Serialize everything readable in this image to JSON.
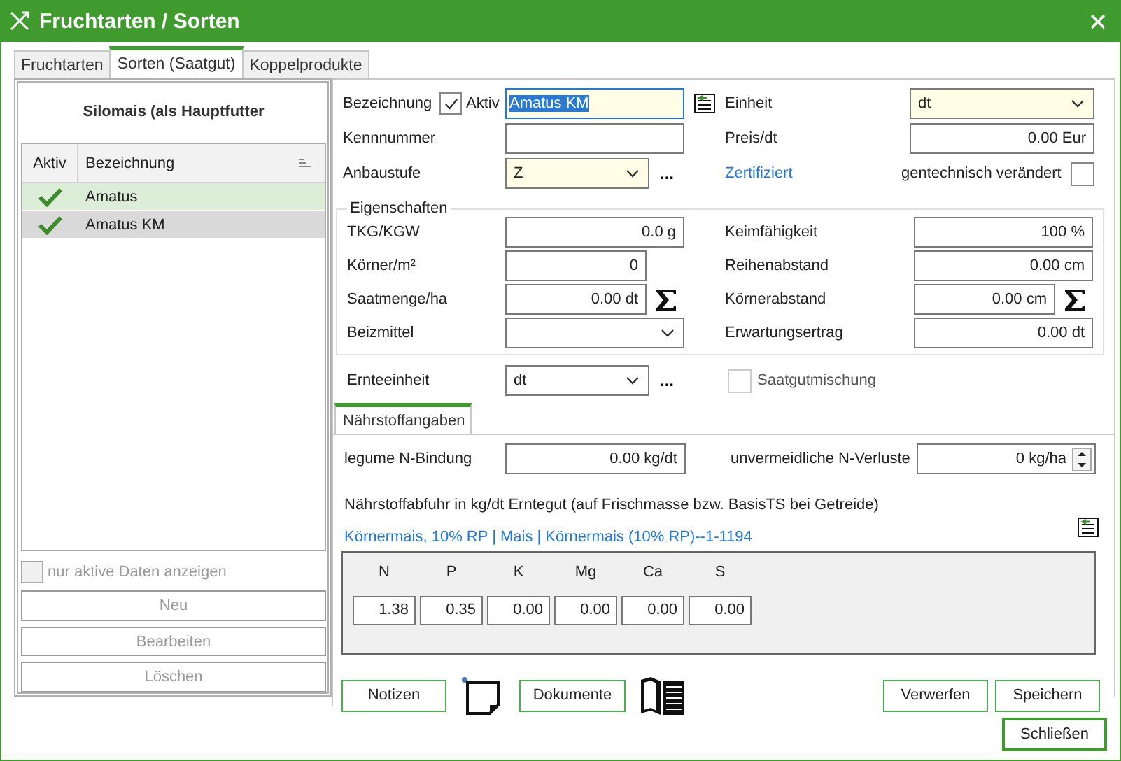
{
  "window": {
    "title": "Fruchtarten / Sorten"
  },
  "tabs": [
    {
      "label": "Fruchtarten",
      "selected": false
    },
    {
      "label": "Sorten (Saatgut)",
      "selected": true
    },
    {
      "label": "Koppelprodukte",
      "selected": false
    }
  ],
  "sidebar": {
    "heading": "Silomais (als Hauptfutter",
    "columns": [
      "Aktiv",
      "Bezeichnung"
    ],
    "rows": [
      {
        "active": true,
        "name": "Amatus",
        "selected": false,
        "hovered": true
      },
      {
        "active": true,
        "name": "Amatus KM",
        "selected": true,
        "hovered": false
      }
    ],
    "only_active": {
      "label": "nur aktive Daten anzeigen",
      "checked": false,
      "disabled": true
    },
    "buttons": [
      {
        "label": "Neu",
        "disabled": true
      },
      {
        "label": "Bearbeiten",
        "disabled": true
      },
      {
        "label": "Löschen",
        "disabled": true
      }
    ]
  },
  "form": {
    "name": {
      "label": "Bezeichnung",
      "active_label": "Aktiv",
      "active": true,
      "value": "Amatus KM",
      "required": true
    },
    "number": {
      "label": "Kennnummer"
    },
    "stage": {
      "label": "Anbaustufe",
      "value": "Z",
      "required": true,
      "more": "..."
    },
    "unit": {
      "label": "Einheit",
      "value": "dt",
      "required": true
    },
    "price": {
      "label": "Preis/dt",
      "value": "0.00 Eur"
    },
    "certified": {
      "label": "Zertifiziert"
    },
    "gmo": {
      "label": "gentechnisch verändert",
      "checked": false
    },
    "properties": {
      "title": "Eigenschaften",
      "left": [
        {
          "kind": "text",
          "label": "TKG/KGW",
          "value": "0.0 g"
        },
        {
          "kind": "text",
          "label": "Körner/m²",
          "value": "0"
        },
        {
          "kind": "sum",
          "label": "Saatmenge/ha",
          "value": "0.00 dt"
        },
        {
          "kind": "combo",
          "label": "Beizmittel"
        }
      ],
      "right": [
        {
          "kind": "text",
          "label": "Keimfähigkeit",
          "value": "100 %"
        },
        {
          "kind": "text",
          "label": "Reihenabstand",
          "value": "0.00 cm"
        },
        {
          "kind": "sum",
          "label": "Körnerabstand",
          "value": "0.00 cm"
        },
        {
          "kind": "text",
          "label": "Erwartungsertrag",
          "value": "0.00 dt"
        }
      ]
    },
    "harvest_unit": {
      "label": "Ernteeinheit",
      "value": "dt",
      "more": "..."
    },
    "seed_mix": {
      "label": "Saatgutmischung",
      "checked": false,
      "disabled": true
    }
  },
  "nutrients": {
    "tab": "Nährstoffangaben",
    "legume": {
      "label": "legume N-Bindung",
      "value": "0.00 kg/dt"
    },
    "losses": {
      "label": "unvermeidliche N-Verluste",
      "value": "0 kg/ha"
    },
    "note": "Nährstoffabfuhr in kg/dt Erntegut (auf Frischmasse bzw. BasisTS bei Getreide)",
    "source": "Körnermais, 10% RP | Mais | Körnermais (10% RP)--1-1194",
    "table": {
      "columns": [
        "N",
        "P",
        "K",
        "Mg",
        "Ca",
        "S"
      ],
      "values": [
        "1.38",
        "0.35",
        "0.00",
        "0.00",
        "0.00",
        "0.00"
      ]
    }
  },
  "actions": {
    "notes": "Notizen",
    "documents": "Dokumente",
    "discard": "Verwerfen",
    "save": "Speichern"
  },
  "close_button": "Schließen"
}
